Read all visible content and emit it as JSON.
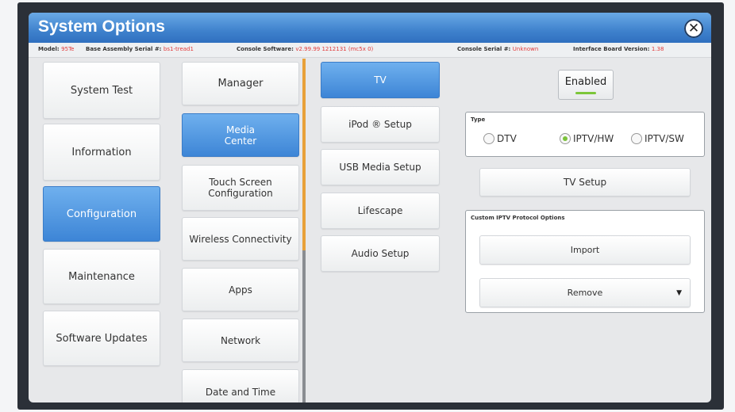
{
  "window": {
    "title": "System Options",
    "close_symbol": "✕"
  },
  "info_bar": {
    "model_label": "Model:",
    "model_value": "95Te",
    "assembly_label": "Base Assembly Serial #:",
    "assembly_value": "bs1-tread1",
    "software_label": "Console Software:",
    "software_value": "v2.99.99 1212131 (mc5x 0)",
    "serial_label": "Console Serial #:",
    "serial_value": "Unknown",
    "interface_label": "Interface Board Version:",
    "interface_value": "1.38"
  },
  "col1": {
    "items": [
      "System Test",
      "Information",
      "Configuration",
      "Maintenance",
      "Software Updates"
    ],
    "selected": "Configuration"
  },
  "col2": {
    "items": [
      "Manager",
      "Media Center",
      "Touch Screen Configuration",
      "Wireless Connectivity",
      "Apps",
      "Network",
      "Date and Time"
    ],
    "selected": "Media Center"
  },
  "col3": {
    "items": [
      "TV",
      "iPod ® Setup",
      "USB Media Setup",
      "Lifescape",
      "Audio Setup"
    ],
    "selected": "TV"
  },
  "tv_panel": {
    "enabled_label": "Enabled",
    "type_label": "Type",
    "type_options": [
      "DTV",
      "IPTV/HW",
      "IPTV/SW"
    ],
    "type_selected": "IPTV/HW",
    "tv_setup_label": "TV Setup",
    "custom_label": "Custom IPTV Protocol Options",
    "import_label": "Import",
    "remove_label": "Remove"
  },
  "colors": {
    "title_blue": "#3f82cd",
    "selected_blue": "#3d85d6",
    "divider_orange": "#e8a13a",
    "status_red": "#e23a3a",
    "led_green": "#7cc63a"
  }
}
